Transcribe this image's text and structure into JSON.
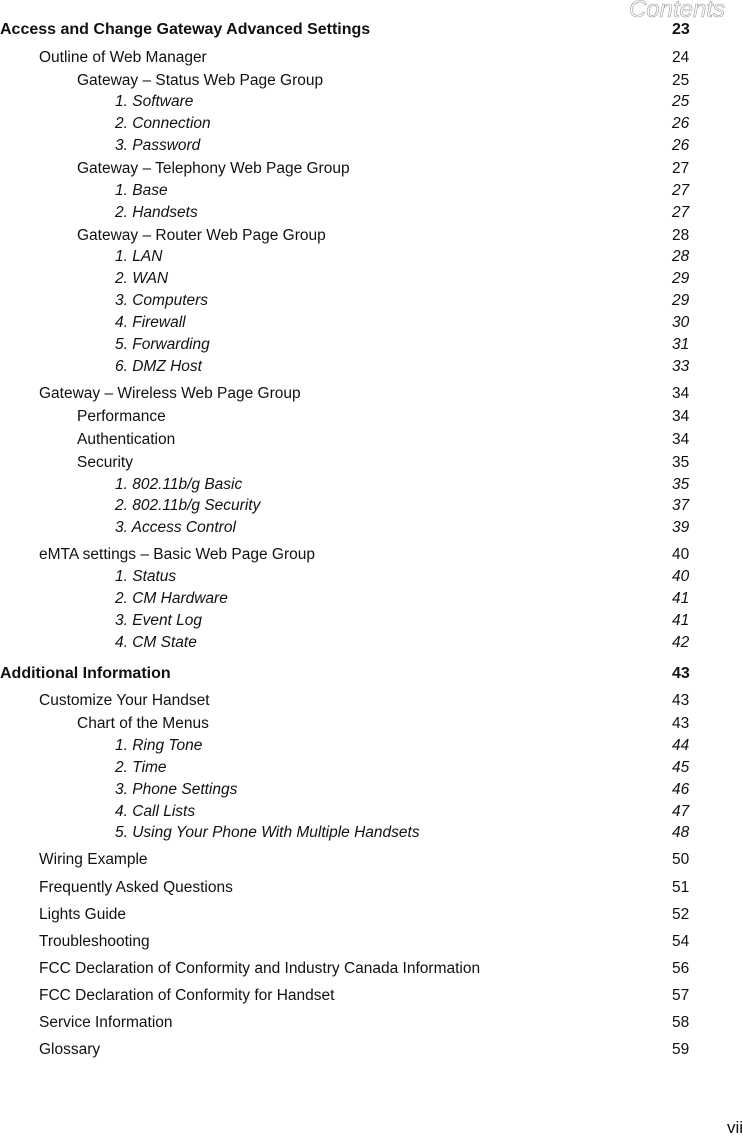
{
  "header": {
    "running_title": "Contents"
  },
  "toc": [
    {
      "title": "Access and Change Gateway Advanced Settings",
      "page": "23",
      "level": 0
    },
    {
      "title": "Outline of Web Manager",
      "page": "24",
      "level": 1
    },
    {
      "title": "Gateway – Status Web Page Group",
      "page": "25",
      "level": 2
    },
    {
      "title": "1. Software",
      "page": "25",
      "level": 3
    },
    {
      "title": "2. Connection",
      "page": "26",
      "level": 3
    },
    {
      "title": "3. Password",
      "page": "26",
      "level": 3
    },
    {
      "title": "Gateway – Telephony Web Page Group",
      "page": "27",
      "level": 2
    },
    {
      "title": "1. Base",
      "page": "27",
      "level": 3
    },
    {
      "title": "2. Handsets",
      "page": "27",
      "level": 3
    },
    {
      "title": "Gateway – Router Web Page Group",
      "page": "28",
      "level": 2
    },
    {
      "title": "1. LAN",
      "page": "28",
      "level": 3
    },
    {
      "title": "2. WAN",
      "page": "29",
      "level": 3
    },
    {
      "title": "3. Computers",
      "page": "29",
      "level": 3
    },
    {
      "title": "4. Firewall",
      "page": "30",
      "level": 3
    },
    {
      "title": "5. Forwarding",
      "page": "31",
      "level": 3
    },
    {
      "title": "6. DMZ Host",
      "page": "33",
      "level": 3
    },
    {
      "title": "Gateway – Wireless Web Page Group",
      "page": "34",
      "level": 1
    },
    {
      "title": "Performance",
      "page": "34",
      "level": 2
    },
    {
      "title": "Authentication",
      "page": "34",
      "level": 2
    },
    {
      "title": "Security",
      "page": "35",
      "level": 2
    },
    {
      "title": "1. 802.11b/g Basic",
      "page": "35",
      "level": 3
    },
    {
      "title": "2. 802.11b/g Security",
      "page": "37",
      "level": 3
    },
    {
      "title": "3. Access Control",
      "page": "39",
      "level": 3
    },
    {
      "title": "eMTA settings – Basic Web Page Group",
      "page": "40",
      "level": 1
    },
    {
      "title": "1. Status",
      "page": "40",
      "level": 3
    },
    {
      "title": "2. CM Hardware",
      "page": "41",
      "level": 3
    },
    {
      "title": "3. Event Log",
      "page": "41",
      "level": 3
    },
    {
      "title": "4. CM State",
      "page": "42",
      "level": 3
    },
    {
      "title": "Additional Information",
      "page": "43",
      "level": 0
    },
    {
      "title": "Customize Your Handset",
      "page": "43",
      "level": 1
    },
    {
      "title": "Chart of the Menus",
      "page": "43",
      "level": 2
    },
    {
      "title": "1. Ring Tone",
      "page": "44",
      "level": 3
    },
    {
      "title": "2. Time",
      "page": "45",
      "level": 3
    },
    {
      "title": "3. Phone Settings",
      "page": "46",
      "level": 3
    },
    {
      "title": "4. Call Lists",
      "page": "47",
      "level": 3
    },
    {
      "title": "5. Using Your Phone With Multiple Handsets",
      "page": "48",
      "level": 3
    },
    {
      "title": "Wiring Example",
      "page": "50",
      "level": 1
    },
    {
      "title": "Frequently Asked Questions",
      "page": "51",
      "level": 1
    },
    {
      "title": "Lights Guide",
      "page": "52",
      "level": 1
    },
    {
      "title": "Troubleshooting",
      "page": "54",
      "level": 1
    },
    {
      "title": "FCC Declaration of Conformity and Industry Canada Information",
      "page": "56",
      "level": 1
    },
    {
      "title": "FCC Declaration of Conformity for Handset",
      "page": "57",
      "level": 1
    },
    {
      "title": "Service Information",
      "page": "58",
      "level": 1
    },
    {
      "title": "Glossary",
      "page": "59",
      "level": 1
    }
  ],
  "footer": {
    "page_number": "vii"
  }
}
